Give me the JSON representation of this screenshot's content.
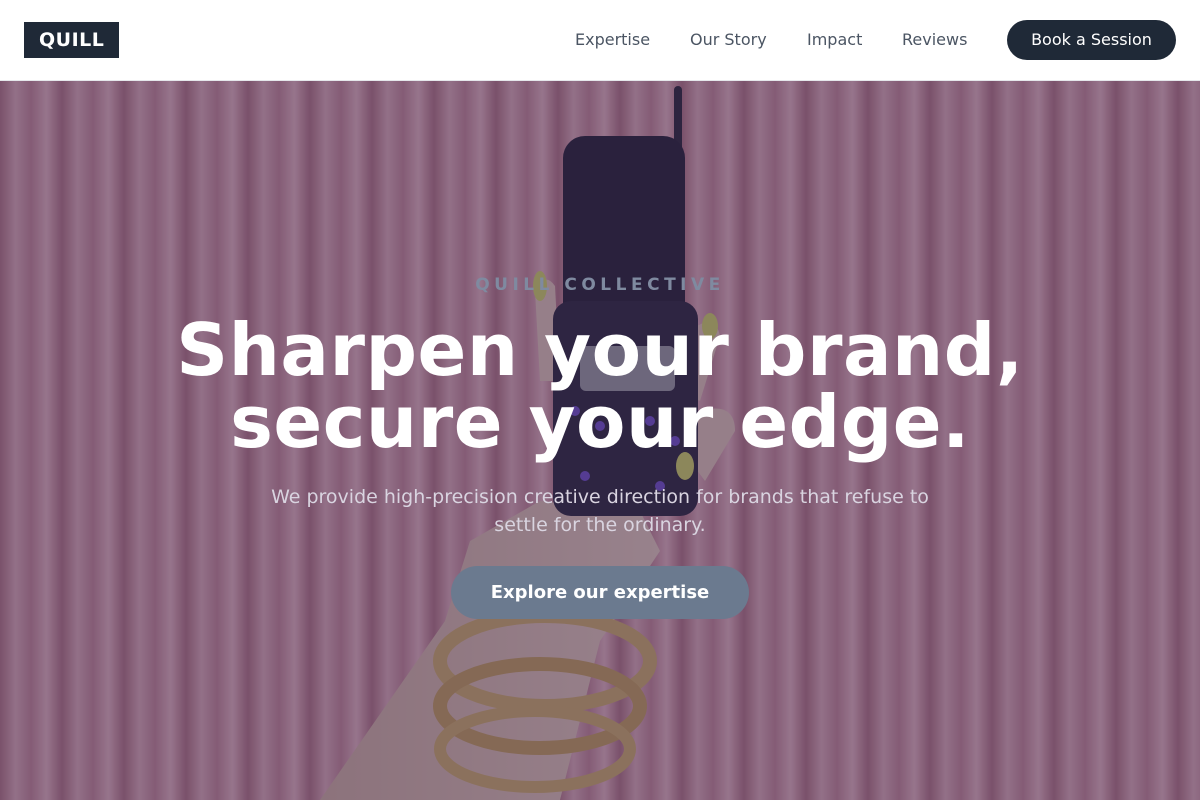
{
  "brand": {
    "logo_text": "QUILL"
  },
  "nav": {
    "items": [
      {
        "label": "Expertise"
      },
      {
        "label": "Our Story"
      },
      {
        "label": "Impact"
      },
      {
        "label": "Reviews"
      }
    ],
    "cta_label": "Book a Session"
  },
  "hero": {
    "eyebrow": "QUILL COLLECTIVE",
    "headline_line1": "Sharpen your brand,",
    "headline_line2": "secure your edge.",
    "subtext": "We provide high-precision creative direction for brands that refuse to settle for the ordinary.",
    "cta_label": "Explore our expertise",
    "image_subject": "hand holding flip phone in front of pink curtain"
  },
  "colors": {
    "dark": "#1f2937",
    "hero_button": "#6b7a8f",
    "curtain": "#c98a9b",
    "overlay": "#402e50"
  }
}
